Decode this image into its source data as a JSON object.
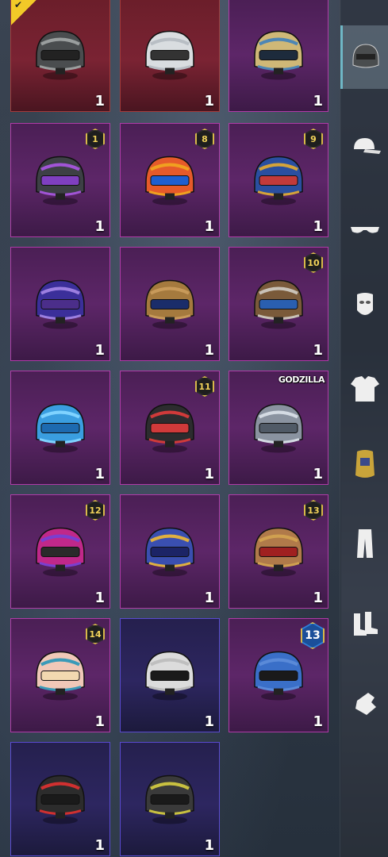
{
  "inventory": {
    "items": [
      {
        "name": "winged-helmet",
        "rarity": "red",
        "qty": "1",
        "badge": "",
        "equipped": true,
        "body": "#4a4d4f",
        "accent": "#9a9e9e",
        "visor": "#222"
      },
      {
        "name": "disco-helmet",
        "rarity": "red",
        "qty": "1",
        "badge": "",
        "equipped": false,
        "body": "#d9dde0",
        "accent": "#b8bec4",
        "visor": "#333"
      },
      {
        "name": "golden-helmet",
        "rarity": "purple",
        "qty": "1",
        "badge": "",
        "equipped": false,
        "body": "#cfb877",
        "accent": "#4d86b5",
        "visor": "#1d2b3c"
      },
      {
        "name": "cyber-helmet",
        "rarity": "purple",
        "qty": "1",
        "badge": "1",
        "equipped": false,
        "body": "#3d4045",
        "accent": "#a154d6",
        "visor": "#7f3fc0"
      },
      {
        "name": "clownfish-helmet",
        "rarity": "purple",
        "qty": "1",
        "badge": "8",
        "equipped": false,
        "body": "#e65a2a",
        "accent": "#f0a020",
        "visor": "#1f5fd0"
      },
      {
        "name": "royal-helmet",
        "rarity": "purple",
        "qty": "1",
        "badge": "9",
        "equipped": false,
        "body": "#2a4fa0",
        "accent": "#d5a33a",
        "visor": "#c23a3a"
      },
      {
        "name": "dragon-helmet",
        "rarity": "purple",
        "qty": "1",
        "badge": "",
        "equipped": false,
        "body": "#3b2f9a",
        "accent": "#9c7fe0",
        "visor": "#4b2e8a"
      },
      {
        "name": "furry-helmet",
        "rarity": "purple",
        "qty": "1",
        "badge": "",
        "equipped": false,
        "body": "#a57a3e",
        "accent": "#c89a5a",
        "visor": "#1a2d6a"
      },
      {
        "name": "viking-helmet",
        "rarity": "purple",
        "qty": "1",
        "badge": "10",
        "equipped": false,
        "body": "#7a5a3a",
        "accent": "#c9c2b8",
        "visor": "#2a5fb0"
      },
      {
        "name": "crystal-helmet",
        "rarity": "purple",
        "qty": "1",
        "badge": "",
        "equipped": false,
        "body": "#3a9ee0",
        "accent": "#7fd3ff",
        "visor": "#1d6ab0"
      },
      {
        "name": "wired-helmet",
        "rarity": "purple",
        "qty": "1",
        "badge": "11",
        "equipped": false,
        "body": "#2c2c2e",
        "accent": "#d03a3a",
        "visor": "#d03a3a"
      },
      {
        "name": "godzilla-helmet",
        "rarity": "purple",
        "qty": "1",
        "badge": "GODZILLA",
        "equipped": false,
        "body": "#8a93a0",
        "accent": "#d4dbe3",
        "visor": "#505a66"
      },
      {
        "name": "neon-bunny-helmet",
        "rarity": "purple",
        "qty": "1",
        "badge": "12",
        "equipped": false,
        "body": "#c0288a",
        "accent": "#7a3fd0",
        "visor": "#2a2a2a"
      },
      {
        "name": "pharaoh-helmet",
        "rarity": "purple",
        "qty": "1",
        "badge": "",
        "equipped": false,
        "body": "#3a4fb0",
        "accent": "#e0b040",
        "visor": "#1c2466"
      },
      {
        "name": "steampunk-helmet",
        "rarity": "purple",
        "qty": "1",
        "badge": "13",
        "equipped": false,
        "body": "#b07a4a",
        "accent": "#d0a050",
        "visor": "#a02020"
      },
      {
        "name": "dog-helmet",
        "rarity": "purple",
        "qty": "1",
        "badge": "14",
        "equipped": false,
        "body": "#f0c8b8",
        "accent": "#3a9ab8",
        "visor": "#f2d9b0"
      },
      {
        "name": "white-lvl3-helmet",
        "rarity": "blue",
        "qty": "1",
        "badge": "",
        "equipped": false,
        "body": "#dcdcdc",
        "accent": "#bfbfbf",
        "visor": "#1a1a1a"
      },
      {
        "name": "blue-lvl3-helmet",
        "rarity": "purple",
        "qty": "1",
        "badge": "13",
        "special": true,
        "equipped": false,
        "body": "#3a6fc8",
        "accent": "#5a8ad8",
        "visor": "#1a1a1a"
      },
      {
        "name": "red-stripe-helmet",
        "rarity": "blue",
        "qty": "1",
        "badge": "",
        "equipped": false,
        "body": "#2c2c2c",
        "accent": "#d03030",
        "visor": "#1a1a1a"
      },
      {
        "name": "yellow-spike-helmet",
        "rarity": "blue",
        "qty": "1",
        "badge": "",
        "equipped": false,
        "body": "#3a3a3a",
        "accent": "#c8c040",
        "visor": "#1a1a1a"
      }
    ]
  },
  "sidebar": {
    "tabs": [
      {
        "name": "helmet",
        "active": true
      },
      {
        "name": "cap",
        "active": false
      },
      {
        "name": "glasses",
        "active": false
      },
      {
        "name": "mask",
        "active": false
      },
      {
        "name": "shirt",
        "active": false
      },
      {
        "name": "armor",
        "active": false
      },
      {
        "name": "pants",
        "active": false
      },
      {
        "name": "shoes",
        "active": false
      },
      {
        "name": "gloves",
        "active": false
      }
    ]
  }
}
